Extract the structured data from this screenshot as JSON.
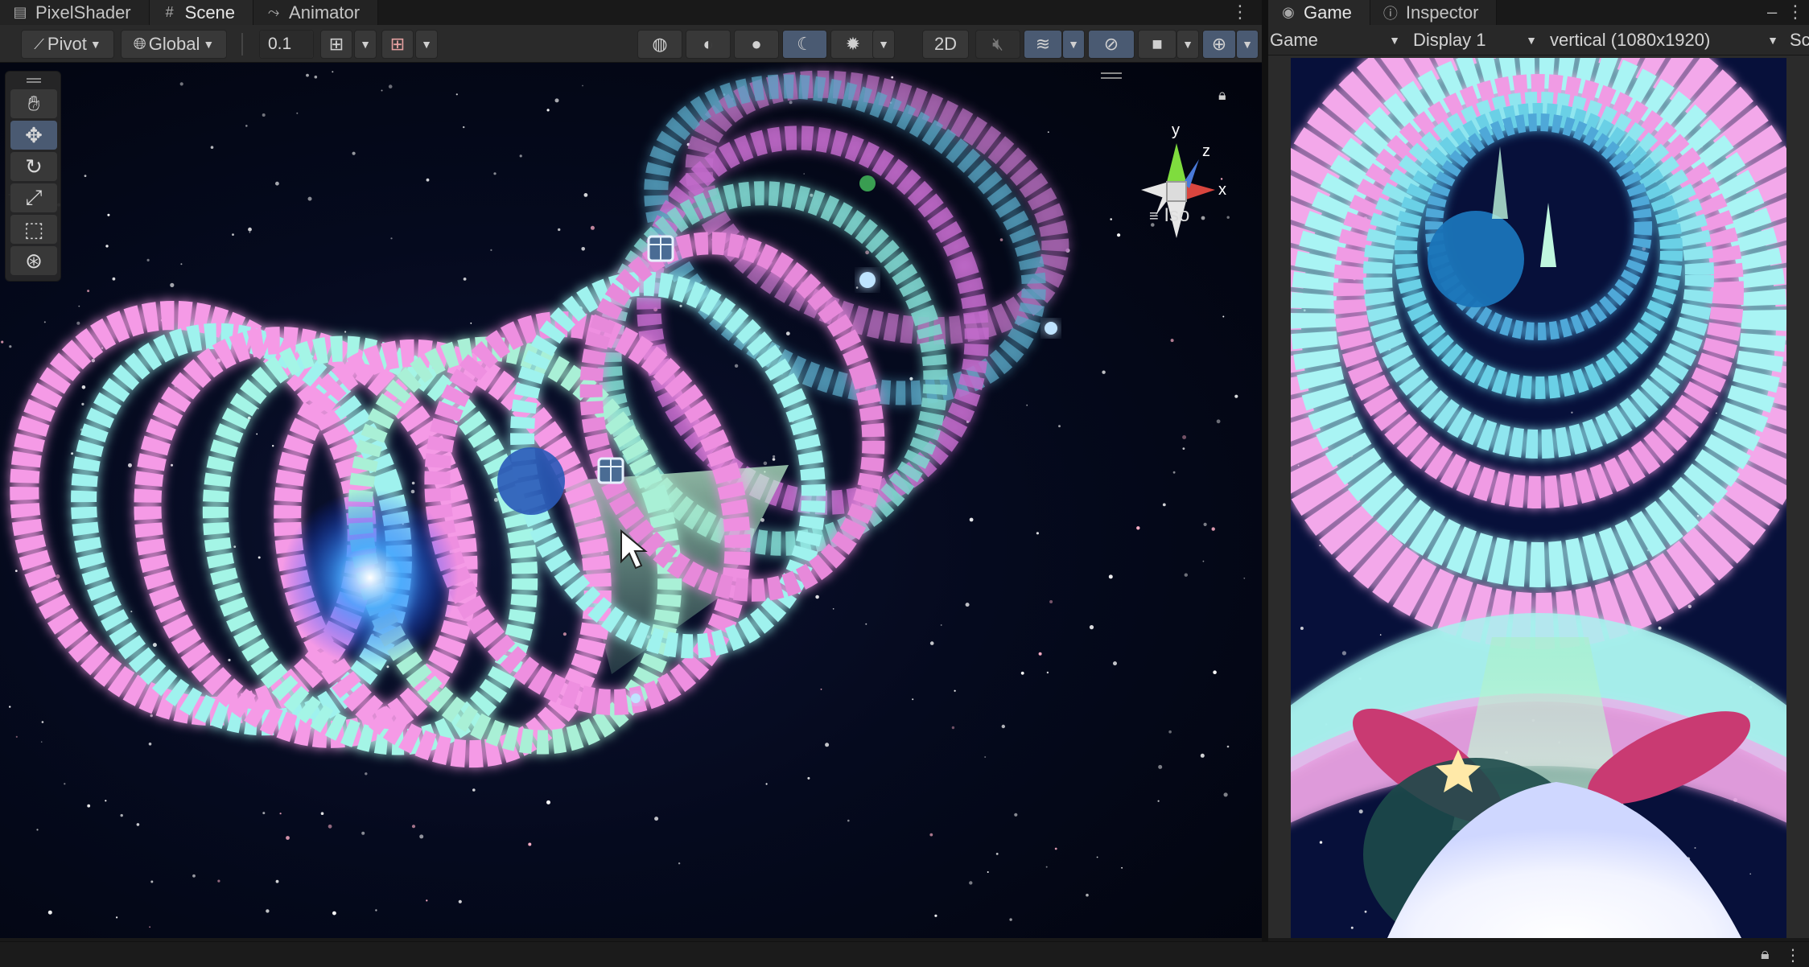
{
  "left_tabs": [
    {
      "label": "PixelShader",
      "icon": "scene-file-icon"
    },
    {
      "label": "Scene",
      "icon": "grid-hash-icon"
    },
    {
      "label": "Animator",
      "icon": "animator-icon"
    }
  ],
  "right_tabs": [
    {
      "label": "Game",
      "icon": "gamepad-icon"
    },
    {
      "label": "Inspector",
      "icon": "info-icon"
    }
  ],
  "scene_toolbar": {
    "pivot_label": "Pivot",
    "global_label": "Global",
    "snap_value": "0.1",
    "mode_2d_label": "2D"
  },
  "scene_view": {
    "projection_label": "Iso",
    "gizmo_axes": {
      "y": "y",
      "z": "z",
      "x": "x"
    }
  },
  "game_toolbar": {
    "view_label": "Game",
    "display_label": "Display 1",
    "resolution_label": "vertical (1080x1920)",
    "scale_label": "Scal"
  },
  "tools": [
    "hand-tool",
    "move-tool",
    "rotate-tool",
    "scale-tool",
    "rect-tool",
    "transform-tool"
  ],
  "colors": {
    "active_button": "#4a5a72",
    "ring_pink": "#f59ae6",
    "ring_cyan": "#9ff2ee",
    "space_bg": "#050a1e"
  }
}
